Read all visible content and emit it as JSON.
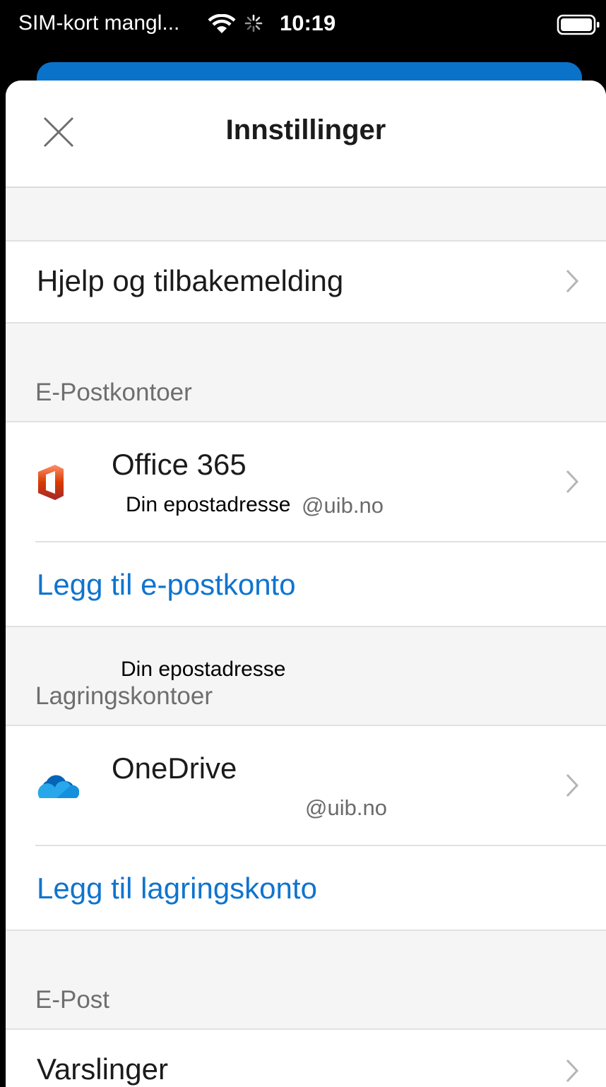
{
  "status_bar": {
    "carrier": "SIM-kort mangl...",
    "time": "10:19",
    "wifi_icon": "wifi-icon",
    "activity_icon": "activity-spinner-icon",
    "battery_icon": "battery-icon"
  },
  "header": {
    "title": "Innstillinger",
    "close_icon": "close-icon"
  },
  "rows": {
    "help": "Hjelp og tilbakemelding",
    "notifications": "Varslinger"
  },
  "sections": {
    "mail_accounts": "E-Postkontoer",
    "storage_accounts": "Lagringskontoer",
    "mail": "E-Post"
  },
  "mail_account": {
    "name": "Office 365",
    "email_prefix": "Din epostadresse",
    "email_domain": "@uib.no",
    "icon": "office-365-icon"
  },
  "add_mail_account": "Legg til e-postkonto",
  "storage_note": "Din epostadresse",
  "storage_account": {
    "name": "OneDrive",
    "email_domain": "@uib.no",
    "icon": "onedrive-icon"
  },
  "add_storage_account": "Legg til lagringskonto",
  "colors": {
    "accent": "#0f74cf",
    "office_red": "#d83b01",
    "onedrive_blue": "#0364b8"
  }
}
